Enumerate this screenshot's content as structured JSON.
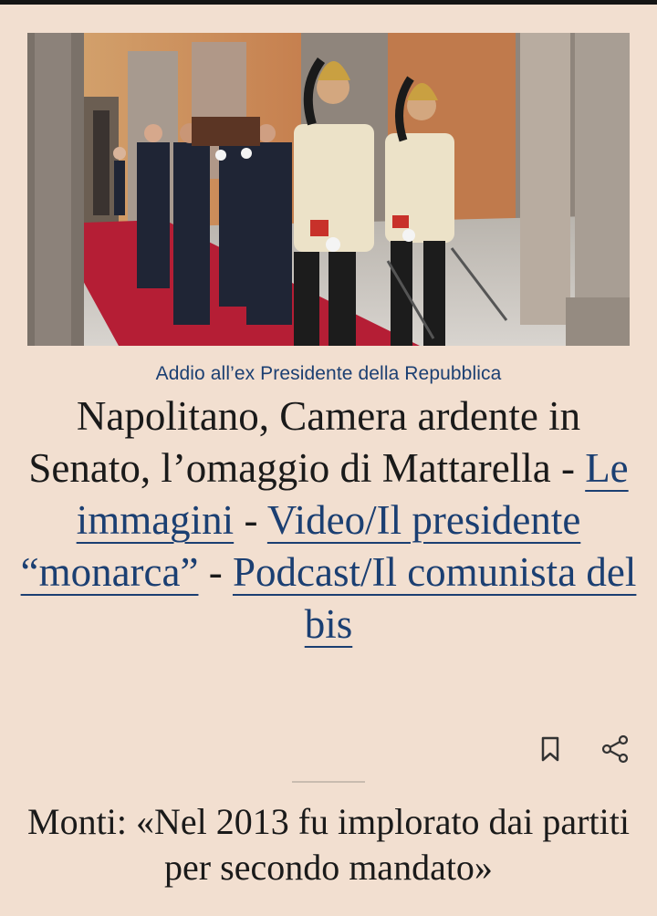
{
  "article": {
    "kicker": "Addio all’ex Presidente della Repubblica",
    "headline": {
      "lead": "Napolitano, Camera ardente in Senato, l’omaggio di Mattarella -",
      "sep1": "-",
      "link1": "Le immagini",
      "link2": "Video/Il presidente “monarca”",
      "sep2": "-",
      "link3": "Podcast/Il comunista del bis"
    },
    "actions": {
      "bookmark_icon": "bookmark-icon",
      "share_icon": "share-icon"
    }
  },
  "next_article": {
    "headline": "Monti: «Nel 2013 fu implorato dai partiti per secondo mandato»"
  },
  "colors": {
    "background": "#f2dfd0",
    "link": "#1b3f72",
    "text": "#1a1a1a",
    "carpet": "#b51e35"
  }
}
